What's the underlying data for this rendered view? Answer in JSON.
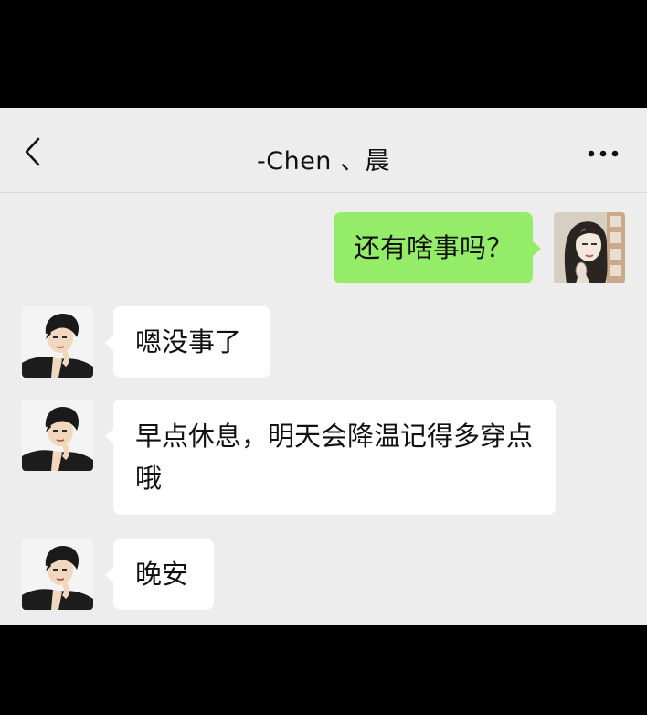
{
  "header": {
    "title": "-Chen 、晨",
    "back_icon": "chevron-left-icon",
    "more_icon": "more-horizontal-icon"
  },
  "colors": {
    "background": "#ededed",
    "sent_bubble": "#95ec69",
    "received_bubble": "#ffffff",
    "frame": "#000000"
  },
  "messages": [
    {
      "direction": "outgoing",
      "sender": "me",
      "text": "还有啥事吗？"
    },
    {
      "direction": "incoming",
      "sender": "Chen",
      "text": "嗯没事了"
    },
    {
      "direction": "incoming",
      "sender": "Chen",
      "text": "早点休息，明天会降温记得多穿点哦"
    },
    {
      "direction": "incoming",
      "sender": "Chen",
      "text": "晚安"
    }
  ]
}
